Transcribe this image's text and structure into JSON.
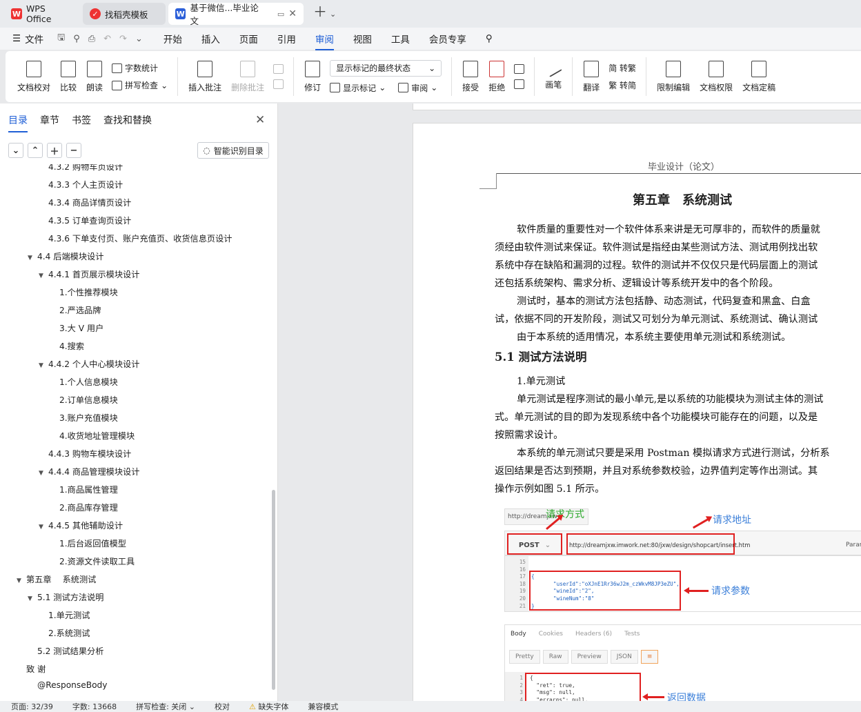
{
  "tabs": {
    "wps_label": "WPS Office",
    "template_label": "找稻壳模板",
    "doc_label": "基于微信...毕业论文"
  },
  "menu": {
    "file": "文件",
    "items": [
      "开始",
      "插入",
      "页面",
      "引用",
      "审阅",
      "视图",
      "工具",
      "会员专享"
    ],
    "active": "审阅"
  },
  "ribbon": {
    "doc_check": "文档校对",
    "compare": "比较",
    "read_aloud": "朗读",
    "word_count": "字数统计",
    "spell_check": "拼写检查",
    "insert_comment": "插入批注",
    "delete_comment": "删除批注",
    "track": "修订",
    "display_state": "显示标记的最终状态",
    "show_markup": "显示标记",
    "review": "审阅",
    "accept": "接受",
    "reject": "拒绝",
    "pen": "画笔",
    "translate": "翻译",
    "to_traditional": "简 转繁",
    "to_simplified": "繁 转简",
    "restrict_edit": "限制编辑",
    "doc_permission": "文档权限",
    "doc_finalize": "文档定稿"
  },
  "nav": {
    "tabs": [
      "目录",
      "章节",
      "书签",
      "查找和替换"
    ],
    "smart_toc": "智能识别目录",
    "toc": [
      {
        "text": "4.3.2 购物车页设计",
        "level": 3,
        "tri": ""
      },
      {
        "text": "4.3.3 个人主页设计",
        "level": 3,
        "tri": ""
      },
      {
        "text": "4.3.4 商品详情页设计",
        "level": 3,
        "tri": ""
      },
      {
        "text": "4.3.5 订单查询页设计",
        "level": 3,
        "tri": ""
      },
      {
        "text": "4.3.6 下单支付页、账户充值页、收货信息页设计",
        "level": 3,
        "tri": ""
      },
      {
        "text": "4.4 后端模块设计",
        "level": 2,
        "tri": "▼"
      },
      {
        "text": "4.4.1 首页展示模块设计",
        "level": 3,
        "tri": "▼"
      },
      {
        "text": "1.个性推荐模块",
        "level": 4,
        "tri": ""
      },
      {
        "text": "2.严选品牌",
        "level": 4,
        "tri": ""
      },
      {
        "text": "3.大 V 用户",
        "level": 4,
        "tri": ""
      },
      {
        "text": "4.搜索",
        "level": 4,
        "tri": ""
      },
      {
        "text": "4.4.2 个人中心模块设计",
        "level": 3,
        "tri": "▼"
      },
      {
        "text": "1.个人信息模块",
        "level": 4,
        "tri": ""
      },
      {
        "text": "2.订单信息模块",
        "level": 4,
        "tri": ""
      },
      {
        "text": "3.账户充值模块",
        "level": 4,
        "tri": ""
      },
      {
        "text": "4.收货地址管理模块",
        "level": 4,
        "tri": ""
      },
      {
        "text": "4.4.3 购物车模块设计",
        "level": 3,
        "tri": ""
      },
      {
        "text": "4.4.4 商品管理模块设计",
        "level": 3,
        "tri": "▼"
      },
      {
        "text": "1.商品属性管理",
        "level": 4,
        "tri": ""
      },
      {
        "text": "2.商品库存管理",
        "level": 4,
        "tri": ""
      },
      {
        "text": "4.4.5 其他辅助设计",
        "level": 3,
        "tri": "▼"
      },
      {
        "text": "1.后台返回值模型",
        "level": 4,
        "tri": ""
      },
      {
        "text": "2.资源文件读取工具",
        "level": 4,
        "tri": ""
      },
      {
        "text": "第五章 　系统测试",
        "level": 1,
        "tri": "▼"
      },
      {
        "text": "5.1 测试方法说明",
        "level": 2,
        "tri": "▼"
      },
      {
        "text": "1.单元测试",
        "level": 3,
        "tri": ""
      },
      {
        "text": "2.系统测试",
        "level": 3,
        "tri": ""
      },
      {
        "text": "5.2 测试结果分析",
        "level": 2,
        "tri": ""
      },
      {
        "text": "致 谢",
        "level": 1,
        "tri": ""
      },
      {
        "text": "@ResponseBody",
        "level": 2,
        "tri": ""
      }
    ]
  },
  "document": {
    "header": "毕业设计（论文）",
    "chapter_title": "第五章　系统测试",
    "p1": [
      "软件质量的重要性对一个软件体系来讲是无可厚非的，而软件的质量就",
      "须经由软件测试来保证。软件测试是指经由某些测试方法、测试用例找出软",
      "系统中存在缺陷和漏洞的过程。软件的测试并不仅仅只是代码层面上的测试",
      "还包括系统架构、需求分析、逻辑设计等系统开发中的各个阶段。"
    ],
    "p2": [
      "测试时，基本的测试方法包括静、动态测试，代码复查和黑盒、白盒",
      "试，依据不同的开发阶段，测试又可划分为单元测试、系统测试、确认测试"
    ],
    "p3": "由于本系统的适用情况，本系统主要使用单元测试和系统测试。",
    "section_title": "5.1 测试方法说明",
    "sub1": "1.单元测试",
    "p4": [
      "单元测试是程序测试的最小单元,是以系统的功能模块为测试主体的测试",
      "式。单元测试的目的即为发现系统中各个功能模块可能存在的问题，以及是",
      "按照需求设计。"
    ],
    "p5": [
      "本系统的单元测试只要是采用 Postman 模拟请求方式进行测试，分析系",
      "返回结果是否达到预期，并且对系统参数校验，边界值判定等作出测试。其",
      "操作示例如图 5.1 所示。"
    ]
  },
  "figure": {
    "url_tab": "http://dreamjxw",
    "anno_method": "请求方式",
    "anno_url": "请求地址",
    "anno_params": "请求参数",
    "anno_return": "返回数据",
    "method": "POST",
    "request_url": "http://dreamjxw.imwork.net:80/jxw/design/shopcart/insert.htm",
    "params_btn": "Params",
    "req_lines": "15\n16\n17\n18\n19\n20\n21",
    "req_code": "\n\n{\n       \"userId\":\"oXJnE1Rr36wJ2m_czWkvM8JP3eZU\",\n       \"wineId\":\"2\",\n       \"wineNum\":\"8\"\n}",
    "resp_tabs": [
      "Body",
      "Cookies",
      "Headers (6)",
      "Tests"
    ],
    "resp_btns": [
      "Pretty",
      "Raw",
      "Preview",
      "JSON"
    ],
    "resp_lines": "1\n2\n3\n4",
    "resp_code": "{\n  \"ret\": true,\n  \"msg\": null,\n  \"errargs\": null,"
  },
  "status": {
    "page": "页面: 32/39",
    "words": "字数: 13668",
    "spell": "拼写检查: 关闭",
    "proof": "校对",
    "missing_font": "缺失字体",
    "compat": "兼容模式"
  }
}
